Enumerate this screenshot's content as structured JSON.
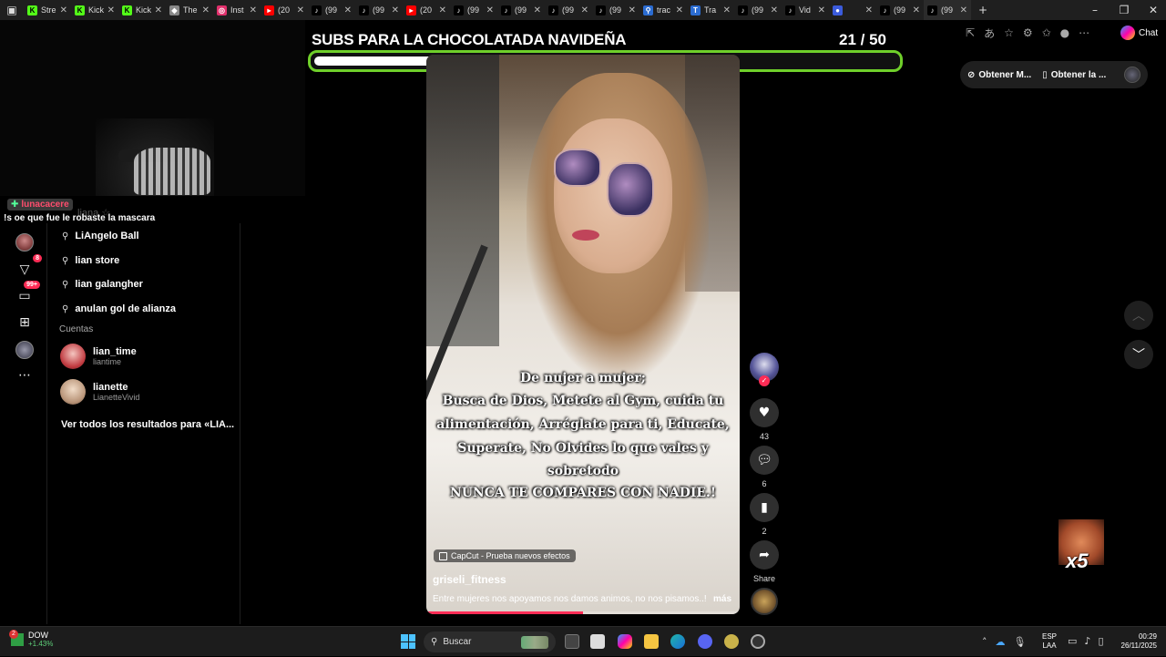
{
  "browser": {
    "tabs": [
      {
        "label": "Stre",
        "color": "#53fc18",
        "glyph": "K"
      },
      {
        "label": "Kick",
        "color": "#53fc18",
        "glyph": "K"
      },
      {
        "label": "Kick",
        "color": "#53fc18",
        "glyph": "K"
      },
      {
        "label": "The",
        "color": "#888888",
        "glyph": "◆"
      },
      {
        "label": "Inst",
        "color": "#e1306c",
        "glyph": "◎"
      },
      {
        "label": "(20",
        "color": "#ff0000",
        "glyph": "▸"
      },
      {
        "label": "(99",
        "color": "#000000",
        "glyph": "♪"
      },
      {
        "label": "(99",
        "color": "#000000",
        "glyph": "♪"
      },
      {
        "label": "(20",
        "color": "#ff0000",
        "glyph": "▸"
      },
      {
        "label": "(99",
        "color": "#000000",
        "glyph": "♪"
      },
      {
        "label": "(99",
        "color": "#000000",
        "glyph": "♪"
      },
      {
        "label": "(99",
        "color": "#000000",
        "glyph": "♪"
      },
      {
        "label": "(99",
        "color": "#000000",
        "glyph": "♪"
      },
      {
        "label": "trac",
        "color": "#2b6cd1",
        "glyph": "⚲"
      },
      {
        "label": "Tra",
        "color": "#2b6cd1",
        "glyph": "T"
      },
      {
        "label": "(99",
        "color": "#000000",
        "glyph": "♪"
      },
      {
        "label": "Vid",
        "color": "#000000",
        "glyph": "♪"
      },
      {
        "label": "",
        "color": "#3b5bdb",
        "glyph": "●"
      },
      {
        "label": "(99",
        "color": "#000000",
        "glyph": "♪"
      },
      {
        "label": "(99",
        "color": "#000000",
        "glyph": "♪"
      }
    ],
    "close_glyph": "✕",
    "new_tab_glyph": "+",
    "chat_label": "Chat"
  },
  "overlay": {
    "title": "SUBS PARA LA CHOCOLATADA NAVIDEÑA",
    "count": "21  / 50",
    "progress": 0.42,
    "accent": "#6fcf2a"
  },
  "stream_chat": {
    "username": "lunacacere",
    "message": "!s oe que fue le robaste la mascara",
    "ghost": "liana ☆"
  },
  "rail": {
    "badge_messages": "8",
    "badge_inbox": "99+"
  },
  "search": {
    "suggestions": [
      "LiAngelo Ball",
      "lian store",
      "lian galangher",
      "anulan gol de alianza"
    ],
    "accounts_label": "Cuentas",
    "accounts": [
      {
        "name": "lian_time",
        "handle": "liantime"
      },
      {
        "name": "lianette",
        "handle": "LianetteVivid"
      }
    ],
    "see_all": "Ver todos los resultados para «LIA..."
  },
  "video": {
    "caption_lines": [
      "De nujer a mujer;",
      "Busca de Dios, Metete al Gym, cuida tu",
      "alimentación, Arréglate para ti, Educate,",
      "Superate, No Olvides lo que vales y",
      "sobretodo",
      "NUNCA TE COMPARES CON NADIE.!"
    ],
    "capcut": "CapCut - Prueba nuevos efectos",
    "username": "griseli_fitness",
    "description": "Entre mujeres nos apoyamos nos damos animos, no nos pisamos..!",
    "more": "más",
    "progress": 0.5
  },
  "actions": {
    "likes": "43",
    "comments": "6",
    "saves": "2",
    "share_label": "Share"
  },
  "top_pills": {
    "get1": "Obtener M...",
    "get2": "Obtener la ..."
  },
  "alert": {
    "multiplier": "x5"
  },
  "taskbar": {
    "ticker": "DOW",
    "ticker_change": "+1.43%",
    "ticker_badge": "2",
    "search_placeholder": "Buscar",
    "lang_line1": "ESP",
    "lang_line2": "LAA",
    "time": "00:29",
    "date": "26/11/2025"
  }
}
